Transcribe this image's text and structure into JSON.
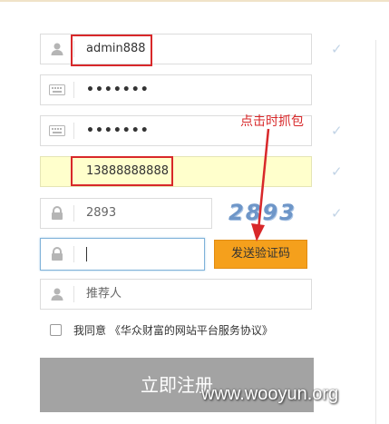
{
  "form": {
    "username_value": "admin888",
    "password_mask": "•••••••",
    "confirm_password_mask": "•••••••",
    "phone_value": "13888888888",
    "captcha_input_value": "2893",
    "captcha_image_text": "2893",
    "sms_code_value": "",
    "send_code_label": "发送验证码",
    "referrer_placeholder": "推荐人",
    "agreement_text": "我同意 《华众财富的网站平台服务协议》",
    "register_label": "立即注册"
  },
  "annotation": {
    "text": "点击时抓包",
    "color": "#d8282a"
  },
  "watermark": "www.wooyun.org",
  "colors": {
    "send_button": "#f5a01c",
    "register_button": "#a3a3a3",
    "phone_field_bg": "#ffffcc",
    "check": "#c2d4e6"
  },
  "icons": [
    "user-icon",
    "keyboard-icon",
    "keyboard-icon",
    "lock-icon",
    "lock-icon",
    "user-icon",
    "check-icon"
  ]
}
